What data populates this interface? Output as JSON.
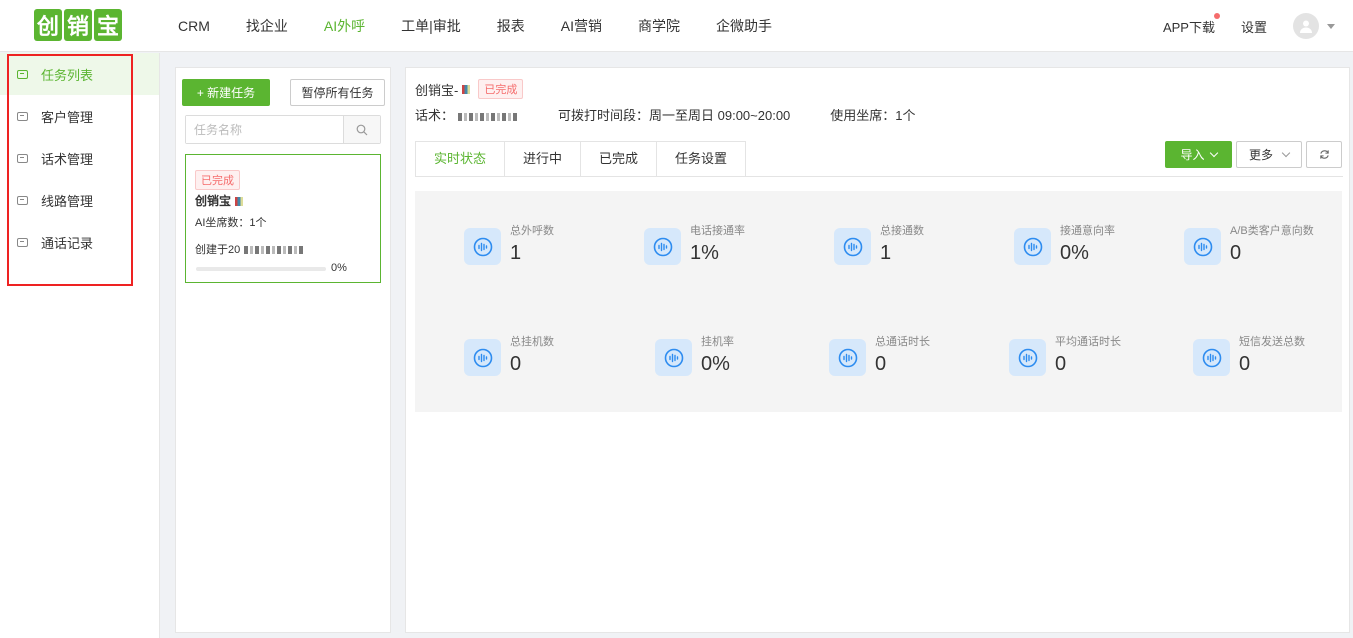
{
  "logo": {
    "chars": [
      "创",
      "销",
      "宝"
    ]
  },
  "nav": {
    "items": [
      "CRM",
      "找企业",
      "AI外呼",
      "工单|审批",
      "报表",
      "AI营销",
      "商学院",
      "企微助手"
    ],
    "active_index": 2,
    "app_download": "APP下载",
    "settings": "设置"
  },
  "sidebar": {
    "items": [
      "任务列表",
      "客户管理",
      "话术管理",
      "线路管理",
      "通话记录"
    ],
    "active_index": 0
  },
  "task_panel": {
    "new_task_label": "+ 新建任务",
    "pause_all_label": "暂停所有任务",
    "search_placeholder": "任务名称",
    "card": {
      "status": "已完成",
      "name": "创销宝",
      "seats": "AI坐席数：1个",
      "created": "创建于20",
      "progress": 0,
      "progress_text": "0%"
    }
  },
  "detail": {
    "title": "创销宝-",
    "status": "已完成",
    "script_label": "话术：",
    "call_window": "可拨打时间段：周一至周日 09:00~20:00",
    "seats_used": "使用坐席：1个",
    "tabs": [
      "实时状态",
      "进行中",
      "已完成",
      "任务设置"
    ],
    "active_tab": 0,
    "import_label": "导入",
    "more_label": "更多",
    "stats": [
      {
        "label": "总外呼数",
        "value": "1"
      },
      {
        "label": "电话接通率",
        "value": "1%"
      },
      {
        "label": "总接通数",
        "value": "1"
      },
      {
        "label": "接通意向率",
        "value": "0%"
      },
      {
        "label": "A/B类客户意向数",
        "value": "0"
      },
      {
        "label": "总挂机数",
        "value": "0"
      },
      {
        "label": "挂机率",
        "value": "0%"
      },
      {
        "label": "总通话时长",
        "value": "0"
      },
      {
        "label": "平均通话时长",
        "value": "0"
      },
      {
        "label": "短信发送总数",
        "value": "0"
      }
    ]
  },
  "colors": {
    "brand": "#5bb531",
    "danger": "#f56c6c",
    "stat_icon_bg": "#d6e8fb",
    "stat_icon_fg": "#2d8cf0"
  }
}
